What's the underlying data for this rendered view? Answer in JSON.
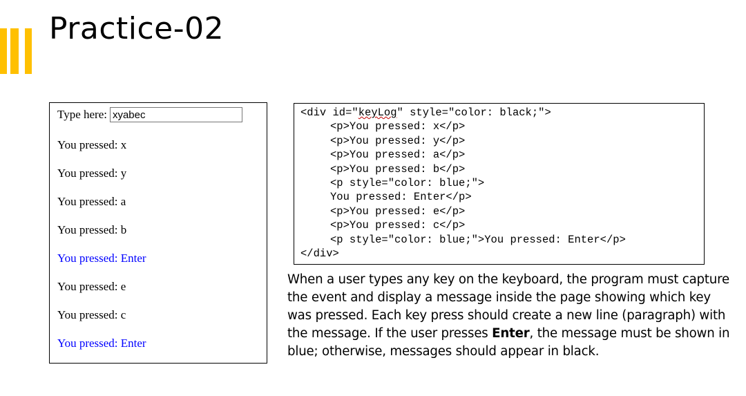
{
  "slide": {
    "title": "Practice-02",
    "accent_color": "#FFC000"
  },
  "demo": {
    "type_label": "Type here:",
    "input_value": "xyabec",
    "log": [
      {
        "text": "You pressed: x",
        "color": "#000000"
      },
      {
        "text": "You pressed: y",
        "color": "#000000"
      },
      {
        "text": "You pressed: a",
        "color": "#000000"
      },
      {
        "text": "You pressed: b",
        "color": "#000000"
      },
      {
        "text": "You pressed: Enter",
        "color": "#0000FF"
      },
      {
        "text": "You pressed: e",
        "color": "#000000"
      },
      {
        "text": "You pressed: c",
        "color": "#000000"
      },
      {
        "text": "You pressed: Enter",
        "color": "#0000FF"
      }
    ]
  },
  "code": {
    "line1_pre": "<div id=\"",
    "line1_id": "keyLog",
    "line1_post": "\" style=\"color: black;\">",
    "lines": [
      "<p>You pressed: x</p>",
      "<p>You pressed: y</p>",
      "<p>You pressed: a</p>",
      "<p>You pressed: b</p>",
      "<p style=\"color: blue;\">",
      "You pressed: Enter</p>",
      "<p>You pressed: e</p>",
      "<p>You pressed: c</p>",
      "<p style=\"color: blue;\">You pressed: Enter</p>"
    ],
    "closing": "</div>"
  },
  "description": {
    "part1": "When a user types any key on the keyboard, the program must capture the event and display a message inside the page showing which key was pressed. Each key press should create a new line (paragraph) with the message. If the user presses ",
    "bold": "Enter",
    "part2": ", the message must be shown in blue; otherwise, messages should appear in black."
  }
}
